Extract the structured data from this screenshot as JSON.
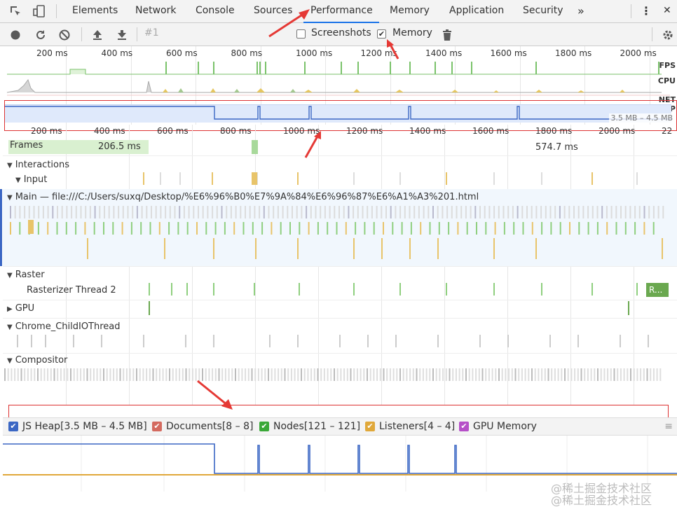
{
  "tabbar": {
    "tabs": [
      {
        "label": "Elements"
      },
      {
        "label": "Network"
      },
      {
        "label": "Console"
      },
      {
        "label": "Sources"
      },
      {
        "label": "Performance"
      },
      {
        "label": "Memory"
      },
      {
        "label": "Application"
      },
      {
        "label": "Security"
      }
    ],
    "more": "»",
    "kebab": "⋮",
    "close": "✕"
  },
  "toolbar": {
    "record_id": "#1",
    "screenshots_label": "Screenshots",
    "screenshots_checked": false,
    "memory_label": "Memory",
    "memory_checked": true
  },
  "overview": {
    "ticks": [
      "200 ms",
      "400 ms",
      "600 ms",
      "800 ms",
      "1000 ms",
      "1200 ms",
      "1400 ms",
      "1600 ms",
      "1800 ms",
      "2000 ms"
    ],
    "labels": {
      "fps": "FPS",
      "cpu": "CPU",
      "net": "NET",
      "heap": "HEAP"
    },
    "heap_range": "3.5 MB – 4.5 MB"
  },
  "timeline": {
    "ticks": [
      "200 ms",
      "400 ms",
      "600 ms",
      "800 ms",
      "1000 ms",
      "1200 ms",
      "1400 ms",
      "1600 ms",
      "1800 ms",
      "2000 ms",
      "22"
    ],
    "frames": {
      "label": "Frames",
      "frame1": "206.5 ms",
      "frame2": "574.7 ms"
    },
    "interactions": "Interactions",
    "input": "Input",
    "main": "Main — file:///C:/Users/suxq/Desktop/%E6%96%B0%E7%9A%84%E6%96%87%E6%A1%A3%201.html",
    "raster": "Raster",
    "rasterizer": "Rasterizer Thread 2",
    "rasterizer_block": "R...",
    "gpu": "GPU",
    "childio": "Chrome_ChildIOThread",
    "compositor": "Compositor"
  },
  "legend": {
    "items": [
      {
        "label": "JS Heap[3.5 MB – 4.5 MB]",
        "color": "#3b67c4"
      },
      {
        "label": "Documents[8 – 8]",
        "color": "#d46a5f"
      },
      {
        "label": "Nodes[121 – 121]",
        "color": "#3aa838"
      },
      {
        "label": "Listeners[4 – 4]",
        "color": "#e0a83a"
      },
      {
        "label": "GPU Memory",
        "color": "#b64fc8"
      }
    ]
  },
  "watermark": "@稀土掘金技术社区"
}
